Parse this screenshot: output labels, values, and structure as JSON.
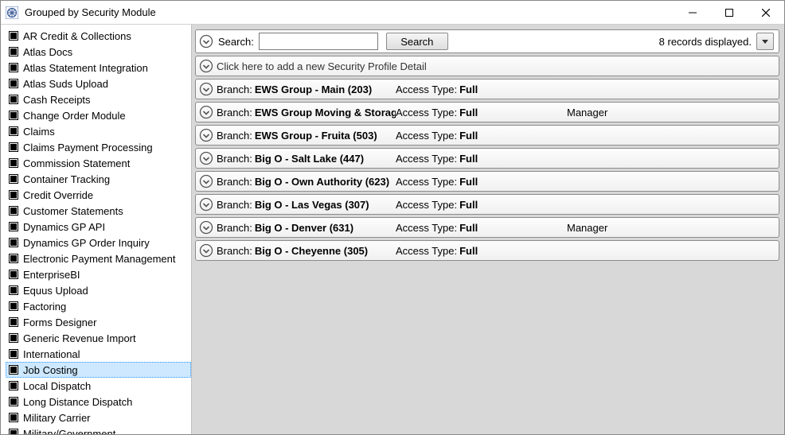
{
  "window": {
    "title": "Grouped by Security Module"
  },
  "sidebar": {
    "selected_index": 21,
    "items": [
      {
        "label": "AR Credit & Collections"
      },
      {
        "label": "Atlas Docs"
      },
      {
        "label": "Atlas Statement Integration"
      },
      {
        "label": "Atlas Suds Upload"
      },
      {
        "label": "Cash Receipts"
      },
      {
        "label": "Change Order Module"
      },
      {
        "label": "Claims"
      },
      {
        "label": "Claims Payment Processing"
      },
      {
        "label": "Commission Statement"
      },
      {
        "label": "Container Tracking"
      },
      {
        "label": "Credit Override"
      },
      {
        "label": "Customer Statements"
      },
      {
        "label": "Dynamics GP API"
      },
      {
        "label": "Dynamics GP Order Inquiry"
      },
      {
        "label": "Electronic Payment Management"
      },
      {
        "label": "EnterpriseBI"
      },
      {
        "label": "Equus Upload"
      },
      {
        "label": "Factoring"
      },
      {
        "label": "Forms Designer"
      },
      {
        "label": "Generic Revenue Import"
      },
      {
        "label": "International"
      },
      {
        "label": "Job Costing"
      },
      {
        "label": "Local Dispatch"
      },
      {
        "label": "Long Distance Dispatch"
      },
      {
        "label": "Military Carrier"
      },
      {
        "label": "Military/Government"
      }
    ]
  },
  "search": {
    "label": "Search:",
    "value": "",
    "button": "Search",
    "records_text": "8 records displayed."
  },
  "add_row": {
    "text": "Click here to add a new Security Profile Detail"
  },
  "field_labels": {
    "branch": "Branch:",
    "access_type": "Access Type:"
  },
  "rows": [
    {
      "branch": "EWS Group - Main (203)",
      "access_type": "Full",
      "extra": ""
    },
    {
      "branch": "EWS Group Moving & Storage (",
      "access_type": "Full",
      "extra": "Manager"
    },
    {
      "branch": "EWS Group - Fruita (503)",
      "access_type": "Full",
      "extra": ""
    },
    {
      "branch": "Big O - Salt Lake (447)",
      "access_type": "Full",
      "extra": ""
    },
    {
      "branch": "Big O - Own Authority (623)",
      "access_type": "Full",
      "extra": ""
    },
    {
      "branch": "Big O - Las Vegas (307)",
      "access_type": "Full",
      "extra": ""
    },
    {
      "branch": "Big O - Denver (631)",
      "access_type": "Full",
      "extra": "Manager"
    },
    {
      "branch": "Big O - Cheyenne (305)",
      "access_type": "Full",
      "extra": ""
    }
  ]
}
